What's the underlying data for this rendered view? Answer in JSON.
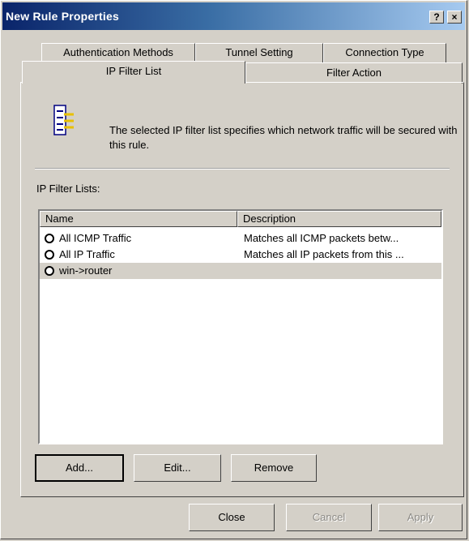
{
  "window": {
    "title": "New Rule Properties",
    "help_glyph": "?",
    "close_glyph": "×"
  },
  "tabs": {
    "back": [
      "Authentication Methods",
      "Tunnel Setting",
      "Connection Type"
    ],
    "front": [
      "IP Filter List",
      "Filter Action"
    ],
    "active": "IP Filter List"
  },
  "panel": {
    "icon": "ip-filter-list-icon",
    "intro": "The selected IP filter list specifies which network traffic will be secured with this rule.",
    "filter_lists_label": "IP Filter Lists:",
    "columns": [
      "Name",
      "Description"
    ],
    "rows": [
      {
        "name": "All ICMP Traffic",
        "description": "Matches all ICMP packets betw...",
        "selected": false
      },
      {
        "name": "All IP Traffic",
        "description": "Matches all IP packets from this ...",
        "selected": false
      },
      {
        "name": "win->router",
        "description": "",
        "selected": true
      }
    ],
    "buttons": {
      "add": "Add...",
      "edit": "Edit...",
      "remove": "Remove"
    }
  },
  "footer": {
    "close": "Close",
    "cancel": "Cancel",
    "apply": "Apply"
  },
  "colors": {
    "face": "#d4d0c8",
    "titlebar_start": "#0a246a",
    "titlebar_end": "#a6caf0",
    "disabled_text": "#8c8a85"
  }
}
